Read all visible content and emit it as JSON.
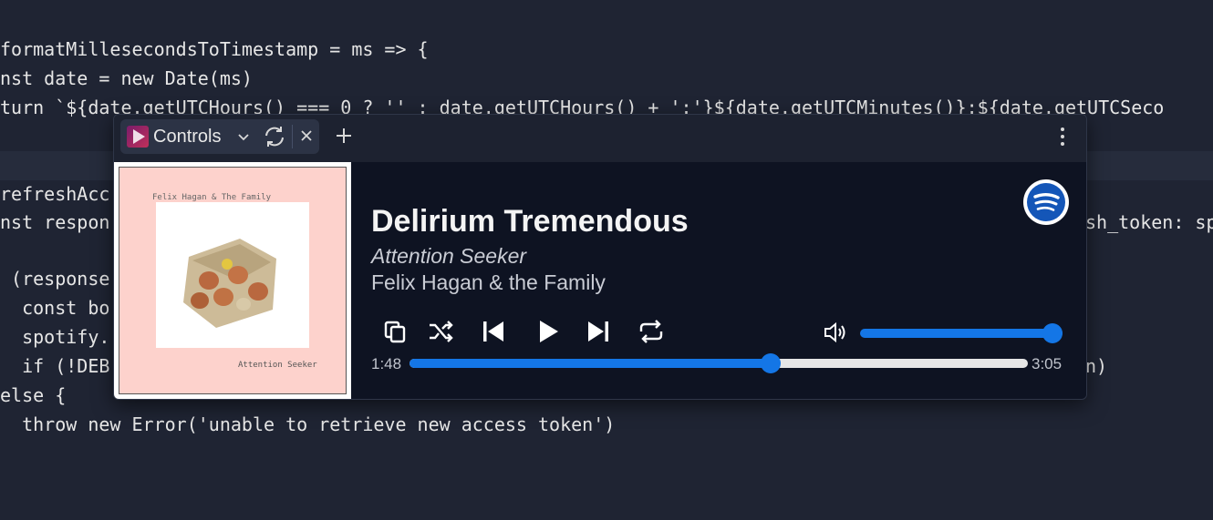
{
  "editor": {
    "lines": [
      "formatMillesecondsToTimestamp = ms => {",
      "nst date = new Date(ms)",
      "turn `${date.getUTCHours() === 0 ? '' : date.getUTCHours() + ':'}${date.getUTCMinutes()}:${date.getUTCSeco",
      "refreshAcc",
      "nst respon",
      "sh_token: sp",
      " (response",
      "  const bo",
      "  spotify.",
      "  if (!DEB",
      "n)",
      "else {",
      "  throw new Error('unable to retrieve new access token')"
    ]
  },
  "tab": {
    "title": "Controls",
    "icons": {
      "logo": "play-logo-icon",
      "dropdown": "chevron-down-icon",
      "refresh": "refresh-icon",
      "close": "close-icon",
      "add": "plus-icon",
      "menu": "more-vertical-icon"
    }
  },
  "cover": {
    "top_text": "Felix Hagan & The Family",
    "bottom_text": "Attention Seeker"
  },
  "track": {
    "title": "Delirium Tremendous",
    "album": "Attention Seeker",
    "artist": "Felix Hagan & the Family"
  },
  "playback": {
    "current_time": "1:48",
    "total_time": "3:05",
    "progress_fraction": 0.584,
    "volume_fraction": 1.0
  },
  "controls": [
    "copy-icon",
    "shuffle-icon",
    "skip-previous-icon",
    "play-icon",
    "skip-next-icon",
    "repeat-icon",
    "volume-icon",
    "spotify-icon"
  ],
  "colors": {
    "accent": "#1476e6",
    "background": "#0e1322",
    "editor_bg": "#1f2433",
    "cover_pink": "#fdd2cc"
  }
}
